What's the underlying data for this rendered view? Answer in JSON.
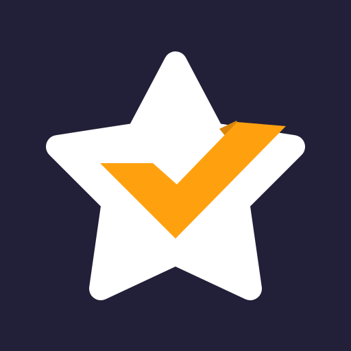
{
  "app_icon": {
    "name": "star-checkmark",
    "colors": {
      "background": "#221f38",
      "star": "#ffffff",
      "check": "#ffa10f",
      "check_shadow": "#d9850b"
    }
  }
}
